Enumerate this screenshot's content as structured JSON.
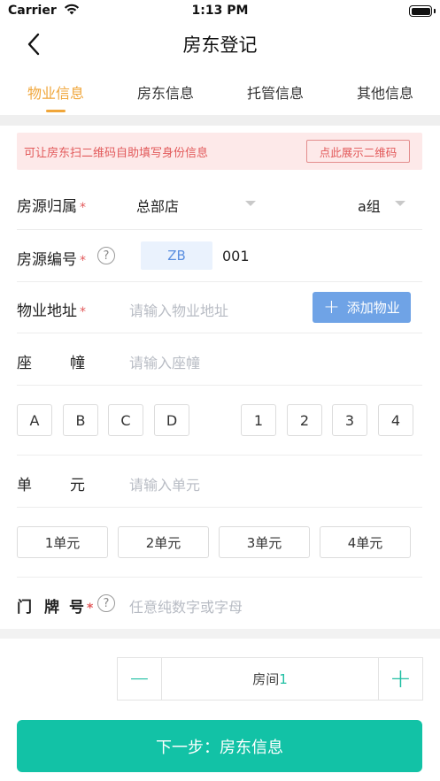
{
  "status_bar": {
    "carrier": "Carrier",
    "time": "1:13 PM"
  },
  "nav": {
    "title": "房东登记"
  },
  "tabs": [
    {
      "label": "物业信息",
      "active": true
    },
    {
      "label": "房东信息",
      "active": false
    },
    {
      "label": "托管信息",
      "active": false
    },
    {
      "label": "其他信息",
      "active": false
    }
  ],
  "notice": {
    "text": "可让房东扫二维码自助填写身份信息",
    "button": "点此展示二维码"
  },
  "form": {
    "source_owner": {
      "label": "房源归属",
      "required": "*",
      "store": "总部店",
      "group": "a组"
    },
    "source_code": {
      "label": "房源编号",
      "required": "*",
      "help": "?",
      "prefix": "ZB",
      "number": "001"
    },
    "address": {
      "label": "物业地址",
      "required": "*",
      "placeholder": "请输入物业地址",
      "add_button": "添加物业",
      "add_icon": "+"
    },
    "building": {
      "label_a": "座",
      "label_b": "幢",
      "placeholder": "请输入座幢"
    },
    "building_options_letters": [
      "A",
      "B",
      "C",
      "D"
    ],
    "building_options_numbers": [
      "1",
      "2",
      "3",
      "4"
    ],
    "unit": {
      "label_a": "单",
      "label_b": "元",
      "placeholder": "请输入单元"
    },
    "unit_options": [
      "1单元",
      "2单元",
      "3单元",
      "4单元"
    ],
    "door": {
      "label_a": "门",
      "label_b": "牌",
      "label_c": "号",
      "required": "*",
      "help": "?",
      "placeholder": "任意纯数字或字母"
    }
  },
  "room_stepper": {
    "minus": "−",
    "label": "房间",
    "count": "1",
    "plus": "+"
  },
  "next_button": "下一步：房东信息",
  "colors": {
    "accent": "#f0a63a",
    "primary": "#12c2a6",
    "notice_bg": "#fde9e9",
    "notice_text": "#e2595a",
    "add_button": "#6fa3e6"
  }
}
